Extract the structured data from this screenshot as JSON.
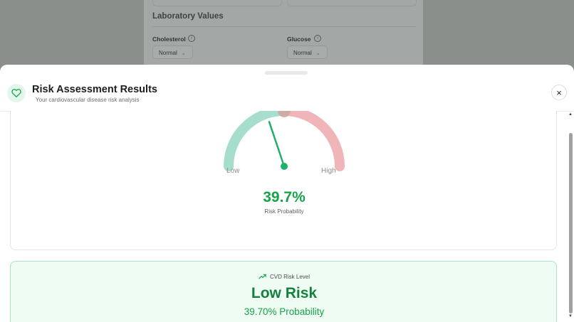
{
  "background_form": {
    "section_title": "Laboratory Values",
    "fields": [
      {
        "label": "Cholesterol",
        "value": "Normal"
      },
      {
        "label": "Glucose",
        "value": "Normal"
      }
    ]
  },
  "modal": {
    "title": "Risk Assessment Results",
    "subtitle": "Your cardiovascular disease risk analysis",
    "close_label": "×",
    "icons": {
      "header": "heart-icon",
      "risk_level": "trending-up-icon",
      "close": "close-icon"
    },
    "gauge": {
      "low_label": "Low",
      "high_label": "High",
      "probability": 0.397,
      "value_text": "39.7%",
      "value_caption": "Risk Probability"
    },
    "risk_card": {
      "level_caption": "CVD Risk Level",
      "level": "Low Risk",
      "probability_text": "39.70% Probability"
    }
  },
  "colors": {
    "accent_green": "#16a34a",
    "gauge_low": "#a7ddcc",
    "gauge_high": "#efb5b8",
    "needle": "#1fb16a"
  }
}
